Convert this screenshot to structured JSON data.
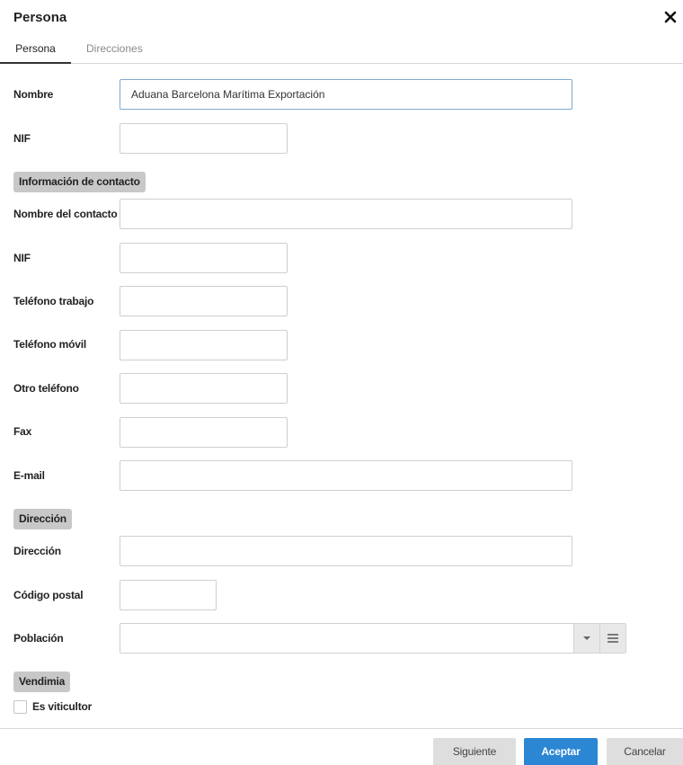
{
  "dialog": {
    "title": "Persona"
  },
  "tabs": [
    {
      "label": "Persona",
      "active": true
    },
    {
      "label": "Direcciones",
      "active": false
    }
  ],
  "form": {
    "nombre": {
      "label": "Nombre",
      "value": "Aduana Barcelona Marítima Exportación"
    },
    "nif": {
      "label": "NIF",
      "value": ""
    },
    "contact_section": "Información de contacto",
    "nombre_contacto": {
      "label": "Nombre del contacto",
      "value": ""
    },
    "nif_contacto": {
      "label": "NIF",
      "value": ""
    },
    "telefono_trabajo": {
      "label": "Teléfono trabajo",
      "value": ""
    },
    "telefono_movil": {
      "label": "Teléfono móvil",
      "value": ""
    },
    "otro_telefono": {
      "label": "Otro teléfono",
      "value": ""
    },
    "fax": {
      "label": "Fax",
      "value": ""
    },
    "email": {
      "label": "E-mail",
      "value": ""
    },
    "address_section": "Dirección",
    "direccion": {
      "label": "Dirección",
      "value": ""
    },
    "codigo_postal": {
      "label": "Código postal",
      "value": ""
    },
    "poblacion": {
      "label": "Población",
      "value": ""
    },
    "vendimia_section": "Vendimia",
    "es_viticultor": {
      "label": "Es viticultor",
      "checked": false
    }
  },
  "footer": {
    "next_label": "Siguiente",
    "accept_label": "Aceptar",
    "cancel_label": "Cancelar"
  },
  "colors": {
    "accent": "#2b86d3",
    "section_bg": "#c8c8c8",
    "button_bg": "#dedede"
  },
  "icons": {
    "close": "close-icon",
    "dropdown": "caret-down-icon",
    "list": "list-icon"
  }
}
